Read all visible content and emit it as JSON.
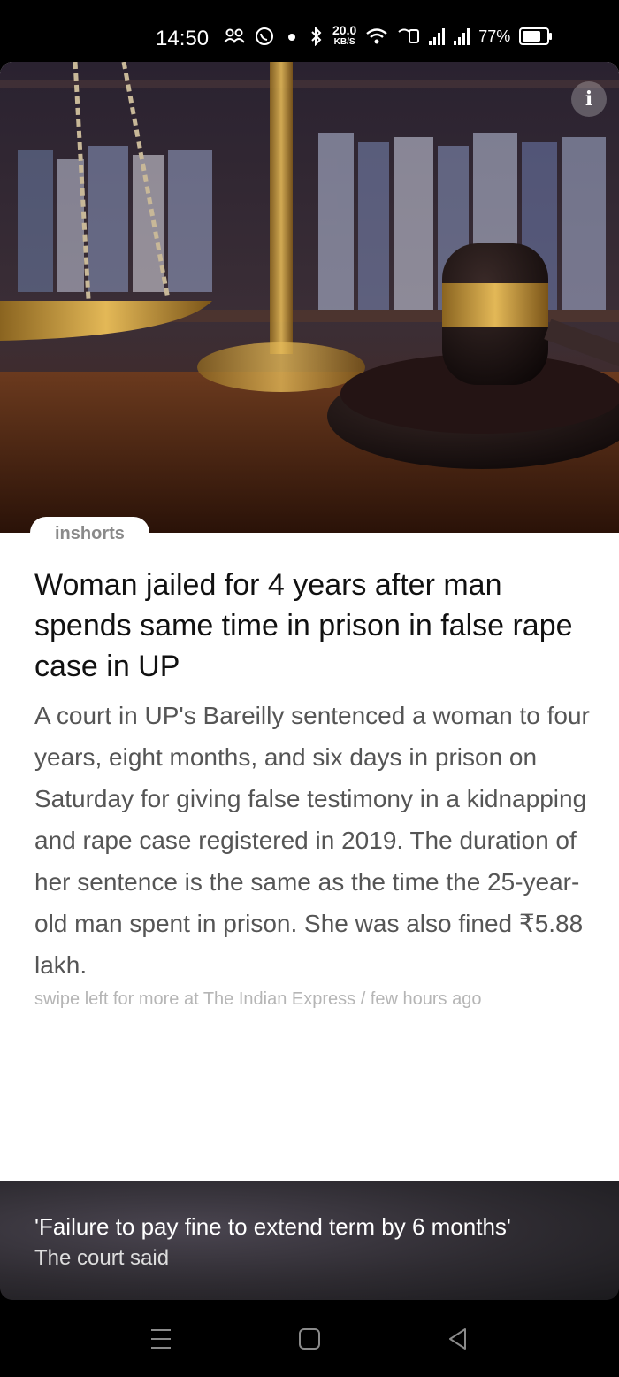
{
  "status_bar": {
    "time": "14:50",
    "speed_value": "20.0",
    "speed_unit": "KB/S",
    "battery_pct": "77%",
    "battery_level": 0.77
  },
  "article": {
    "brand": "inshorts",
    "headline": "Woman jailed for 4 years after man spends same time in prison in false rape case in UP",
    "body": "A court in UP's Bareilly sentenced a woman to four years, eight months, and six days in prison on Saturday for giving false testimony in a kidnapping and rape case registered in 2019. The duration of her sentence is the same as the time the 25-year-old man spent in prison. She was also fined ₹5.88 lakh.",
    "source_line": "swipe left for more at The Indian Express / few hours ago",
    "info_icon": "i"
  },
  "footer": {
    "title": "'Failure to pay fine to extend term by 6 months'",
    "subtitle": "The court said"
  },
  "colors": {
    "headline": "#111111",
    "body": "#555555",
    "source": "#b5b5b5",
    "footer_bg": "#2e2b31"
  }
}
